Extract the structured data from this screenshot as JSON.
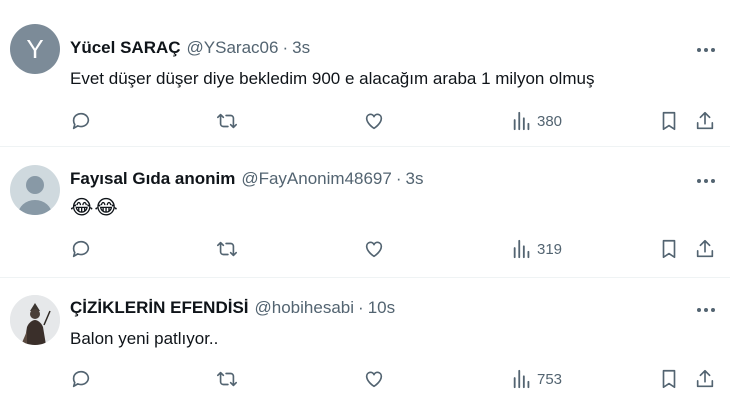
{
  "colors": {
    "text": "#0f1419",
    "muted": "#536471",
    "divider": "#eff3f4"
  },
  "tweets": [
    {
      "name": "Yücel SARAÇ",
      "handle": "@YSarac06",
      "sep": "·",
      "time": "3s",
      "avatar_letter": "Y",
      "text": "Evet düşer düşer diye bekledim 900 e alacağım araba 1 milyon olmuş",
      "views": "380"
    },
    {
      "name": "Fayısal Gıda anonim",
      "handle": "@FayAnonim48697",
      "sep": "·",
      "time": "3s",
      "text": "😂😂",
      "views": "319"
    },
    {
      "name": "ÇİZİKLERİN EFENDİSİ",
      "handle": "@hobihesabi",
      "sep": "·",
      "time": "10s",
      "text": "Balon yeni patlıyor..",
      "views": "753"
    }
  ],
  "icons": [
    "more-icon",
    "reply-icon",
    "retweet-icon",
    "like-icon",
    "views-icon",
    "bookmark-icon",
    "share-icon"
  ]
}
